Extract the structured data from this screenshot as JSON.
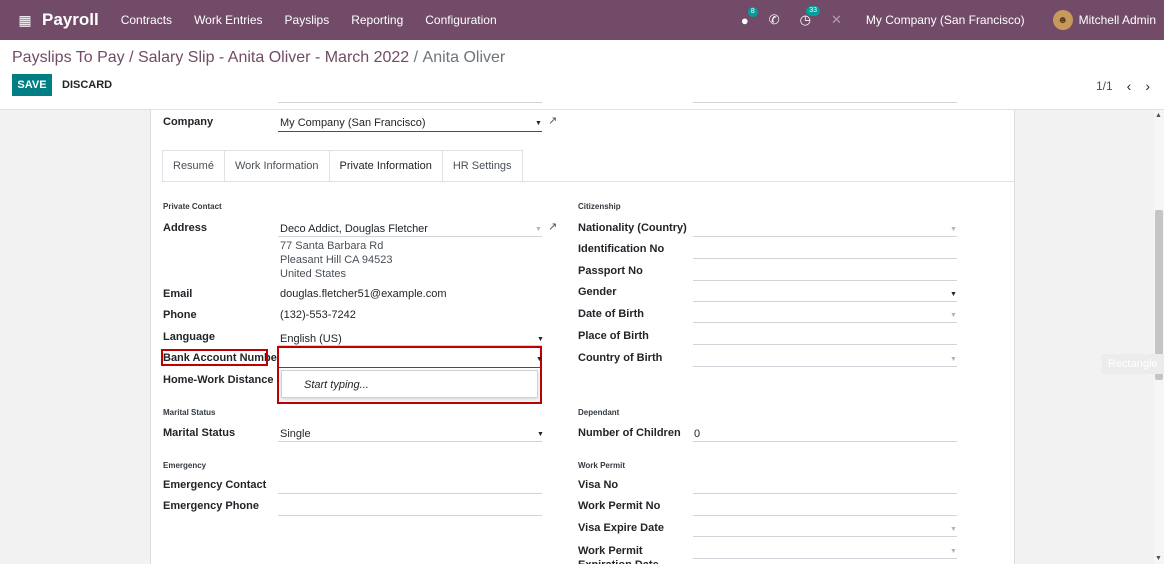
{
  "navbar": {
    "app_name": "Payroll",
    "menus": [
      "Contracts",
      "Work Entries",
      "Payslips",
      "Reporting",
      "Configuration"
    ],
    "chat_count": "8",
    "activity_count": "33",
    "company": "My Company (San Francisco)",
    "user": "Mitchell Admin"
  },
  "breadcrumb": {
    "parent": "Payslips To Pay / Salary Slip - Anita Oliver - March 2022",
    "separator": " / ",
    "current": "Anita Oliver"
  },
  "actions": {
    "save": "SAVE",
    "discard": "DISCARD"
  },
  "pager": {
    "value": "1/1"
  },
  "header_fields": {
    "company_label": "Company",
    "company_value": "My Company (San Francisco)"
  },
  "tabs": [
    "Resumé",
    "Work Information",
    "Private Information",
    "HR Settings"
  ],
  "private_contact": {
    "title": "Private Contact",
    "address_label": "Address",
    "address_name": "Deco Addict, Douglas Fletcher",
    "address_lines": [
      "77 Santa Barbara Rd",
      "Pleasant Hill CA 94523",
      "United States"
    ],
    "email_label": "Email",
    "email_value": "douglas.fletcher51@example.com",
    "phone_label": "Phone",
    "phone_value": "(132)-553-7242",
    "language_label": "Language",
    "language_value": "English (US)",
    "bank_label": "Bank Account Number",
    "bank_value": "",
    "bank_dropdown_hint": "Start typing...",
    "distance_label": "Home-Work Distance"
  },
  "citizenship": {
    "title": "Citizenship",
    "nationality_label": "Nationality (Country)",
    "identification_label": "Identification No",
    "passport_label": "Passport No",
    "gender_label": "Gender",
    "dob_label": "Date of Birth",
    "pob_label": "Place of Birth",
    "cob_label": "Country of Birth"
  },
  "marital": {
    "title": "Marital Status",
    "label": "Marital Status",
    "value": "Single"
  },
  "dependant": {
    "title": "Dependant",
    "children_label": "Number of Children",
    "children_value": "0"
  },
  "emergency": {
    "title": "Emergency",
    "contact_label": "Emergency Contact",
    "phone_label": "Emergency Phone"
  },
  "work_permit": {
    "title": "Work Permit",
    "visa_label": "Visa No",
    "permit_no_label": "Work Permit No",
    "visa_expire_label": "Visa Expire Date",
    "permit_exp_label": "Work Permit Expiration Date"
  },
  "tooltip": {
    "text": "Rectangle"
  },
  "colors": {
    "navbar": "#714b67",
    "save": "#017e84",
    "highlight": "#c00000"
  }
}
